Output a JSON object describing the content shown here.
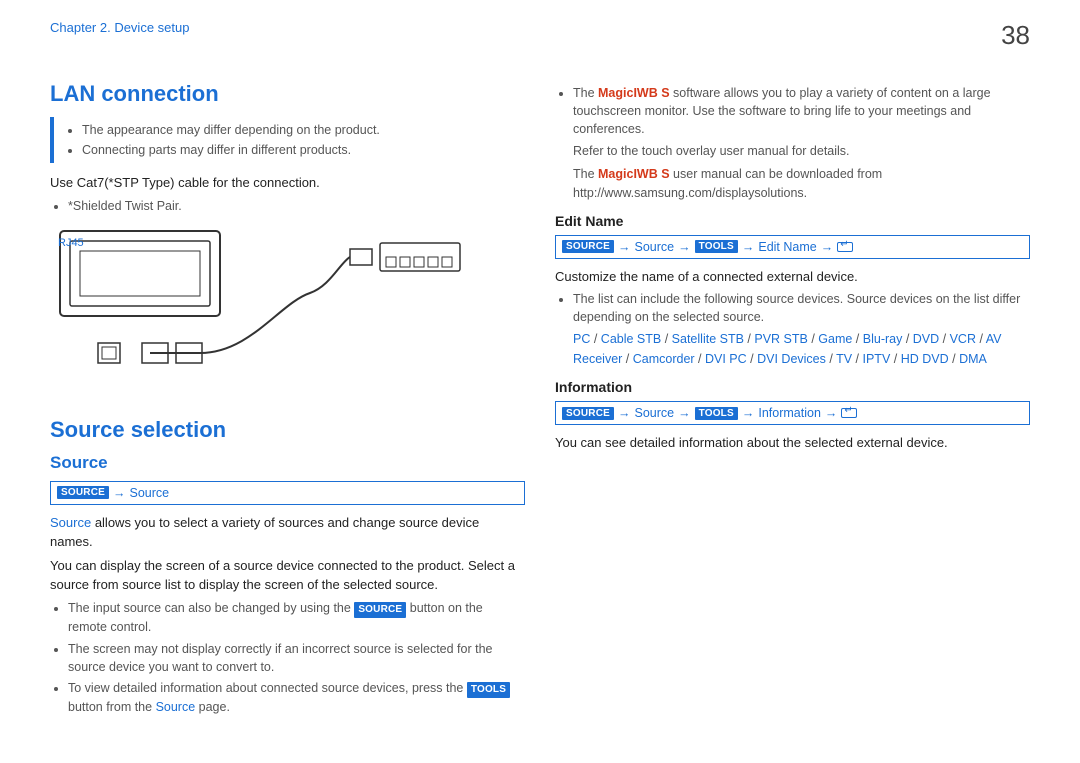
{
  "header": {
    "chapter": "Chapter 2. Device setup",
    "page": "38"
  },
  "left": {
    "lan_heading": "LAN connection",
    "notes": [
      "The appearance may differ depending on the product.",
      "Connecting parts may differ in different products."
    ],
    "cable_line": "Use Cat7(*STP Type) cable for the connection.",
    "stp": "*Shielded Twist Pair.",
    "rj45": "RJ45",
    "source_heading": "Source selection",
    "source_sub": "Source",
    "nav_source_btn": "SOURCE",
    "nav_source_text": "Source",
    "p1_source_word": "Source",
    "p1_rest": " allows you to select a variety of sources and change source device names.",
    "p2": "You can display the screen of a source device connected to the product. Select a source from source list to display the screen of the selected source.",
    "b1a": "The input source can also be changed by using the ",
    "b1_btn": "SOURCE",
    "b1b": " button on the remote control.",
    "b2": "The screen may not display correctly if an incorrect source is selected for the source device you want to convert to.",
    "b3a": "To view detailed information about connected source devices, press the ",
    "b3_btn": "TOOLS",
    "b3b": " button from the ",
    "b3_src": "Source",
    "b3c": " page."
  },
  "right": {
    "m1a": "The ",
    "m1_red": "MagicIWB S",
    "m1b": " software allows you to play a variety of content on a large touchscreen monitor. Use the software to bring life to your meetings and conferences.",
    "m2": "Refer to the touch overlay user manual for details.",
    "m3a": "The ",
    "m3_red": "MagicIWB S",
    "m3b": " user manual can be downloaded from http://www.samsung.com/displaysolutions.",
    "edit_heading": "Edit Name",
    "nav_edit": {
      "btn1": "SOURCE",
      "t1": "Source",
      "btn2": "TOOLS",
      "t2": "Edit Name"
    },
    "edit_p": "Customize the name of a connected external device.",
    "edit_b1": "The list can include the following source devices. Source devices on the list differ depending on the selected source.",
    "devices": [
      "PC",
      "Cable STB",
      "Satellite STB",
      "PVR STB",
      "Game",
      "Blu-ray",
      "DVD",
      "VCR",
      "AV Receiver",
      "Camcorder",
      "DVI PC",
      "DVI Devices",
      "TV",
      "IPTV",
      "HD DVD",
      "DMA"
    ],
    "info_heading": "Information",
    "nav_info": {
      "btn1": "SOURCE",
      "t1": "Source",
      "btn2": "TOOLS",
      "t2": "Information"
    },
    "info_p": "You can see detailed information about the selected external device."
  }
}
